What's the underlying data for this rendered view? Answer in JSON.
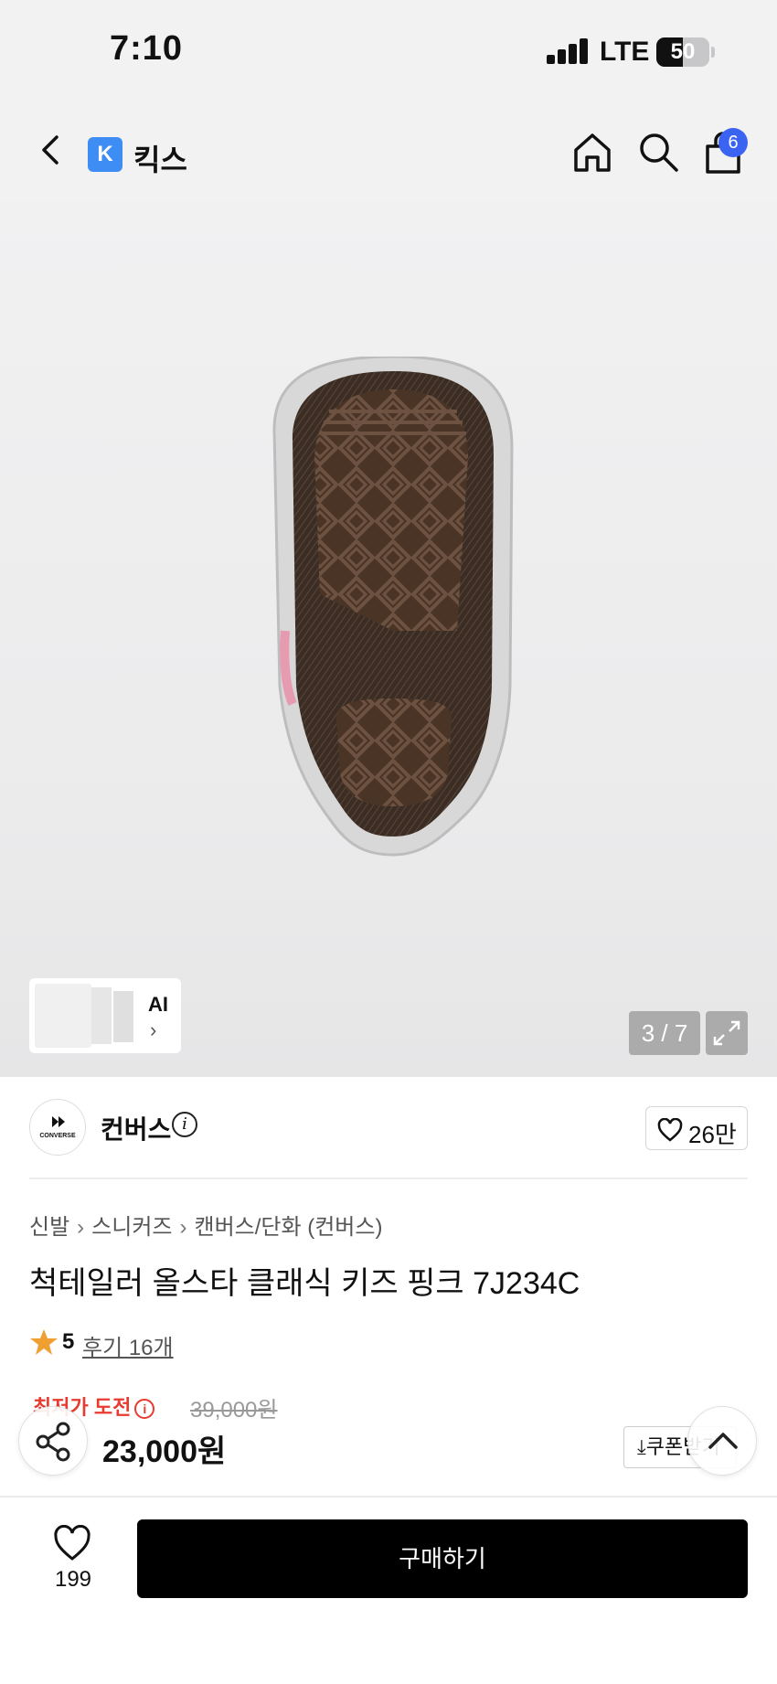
{
  "status_bar": {
    "time": "7:10",
    "network": "LTE",
    "battery": "50",
    "battery_level": 0.5
  },
  "nav": {
    "logo_letter": "K",
    "title": "킥스",
    "cart_count": "6"
  },
  "gallery": {
    "ai_label": "AI",
    "ai_chevron": "›",
    "counter": "3 / 7"
  },
  "brand": {
    "logo_text": "CONVERSE",
    "name": "컨버스",
    "like_count": "26만"
  },
  "breadcrumb": [
    "신발",
    "스니커즈",
    "캔버스/단화 (컨버스)"
  ],
  "product": {
    "title": "척테일러 올스타 클래식 키즈 핑크 7J234C",
    "rating": "5",
    "review_link": "후기 16개",
    "lowest_label": "최저가 도전",
    "original_price": "39,000원",
    "sale_price": "23,000원",
    "coupon_label": "쿠폰받기"
  },
  "bottom": {
    "wish_count": "199",
    "buy_label": "구매하기"
  },
  "colors": {
    "accent_blue": "#3d8df5",
    "badge_blue": "#3b63f2",
    "sale_red": "#e83a2f",
    "star": "#f0a030"
  }
}
